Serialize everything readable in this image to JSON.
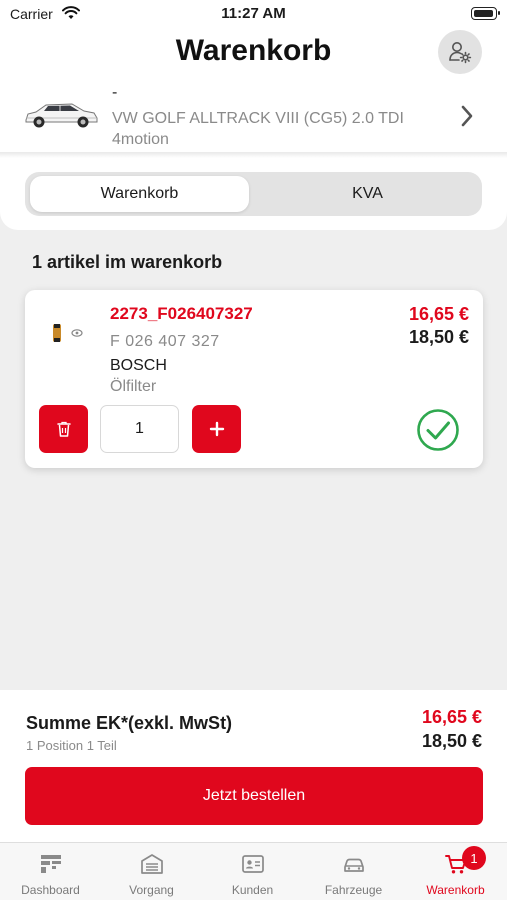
{
  "status_bar": {
    "carrier": "Carrier",
    "time": "11:27 AM"
  },
  "header": {
    "title": "Warenkorb",
    "profile_icon": "user-settings-icon"
  },
  "vehicle": {
    "dash": "-",
    "name": "VW GOLF ALLTRACK VIII (CG5) 2.0 TDI 4motion"
  },
  "segments": {
    "tabs": [
      {
        "label": "Warenkorb",
        "active": true
      },
      {
        "label": "KVA",
        "active": false
      }
    ]
  },
  "cart": {
    "count_label": "1 artikel im warenkorb",
    "items": [
      {
        "code": "2273_F026407327",
        "number": "F 026 407 327",
        "brand": "BOSCH",
        "description": "Ölfilter",
        "price_ek": "16,65 €",
        "price_vk": "18,50 €",
        "quantity": "1",
        "available": true
      }
    ]
  },
  "summary": {
    "title": "Summe EK*(exkl. MwSt)",
    "subtitle": "1 Position 1 Teil",
    "total_ek": "16,65 €",
    "total_vk": "18,50 €",
    "order_button": "Jetzt bestellen"
  },
  "tabbar": {
    "items": [
      {
        "label": "Dashboard",
        "icon": "dashboard-icon"
      },
      {
        "label": "Vorgang",
        "icon": "garage-icon"
      },
      {
        "label": "Kunden",
        "icon": "id-card-icon"
      },
      {
        "label": "Fahrzeuge",
        "icon": "car-icon"
      },
      {
        "label": "Warenkorb",
        "icon": "cart-icon",
        "badge": "1",
        "active": true
      }
    ]
  },
  "colors": {
    "accent": "#e0071d",
    "success": "#2fa84f",
    "muted": "#8a8a8a"
  }
}
